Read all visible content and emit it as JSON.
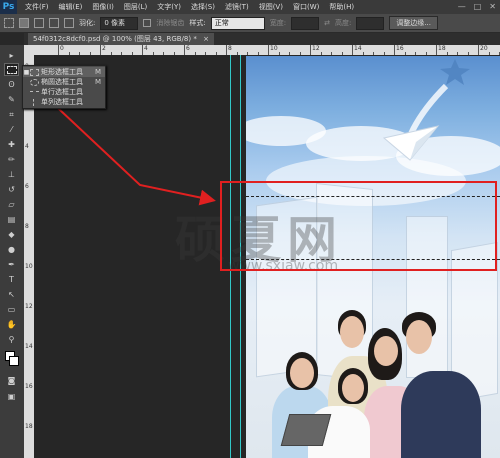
{
  "app": {
    "logo": "Ps",
    "menu": [
      "文件(F)",
      "编辑(E)",
      "图像(I)",
      "图层(L)",
      "文字(Y)",
      "选择(S)",
      "滤镜(T)",
      "视图(V)",
      "窗口(W)",
      "帮助(H)"
    ],
    "window_controls": [
      "—",
      "□",
      "✕"
    ]
  },
  "options": {
    "feather_label": "羽化:",
    "feather_value": "0 像素",
    "antialias_label": "消除锯齿",
    "style_label": "样式:",
    "style_value": "正常",
    "width_label": "宽度:",
    "height_label": "高度:",
    "refine_button": "调整边缘..."
  },
  "document": {
    "tab_title": "54f0312c8dcf0.psd @ 100% (图层 43, RGB/8) *",
    "tab_close": "×"
  },
  "ruler": {
    "top_labels": [
      "0",
      "2",
      "4",
      "6",
      "8",
      "10",
      "12",
      "14",
      "16",
      "18",
      "20"
    ],
    "left_labels": [
      "0",
      "2",
      "4",
      "6",
      "8",
      "10",
      "12",
      "14",
      "16",
      "18",
      "20"
    ]
  },
  "flyout": {
    "items": [
      {
        "label": "矩形选框工具",
        "key": "M",
        "selected": true,
        "icon": "rect-marquee-icon"
      },
      {
        "label": "椭圆选框工具",
        "key": "M",
        "selected": false,
        "icon": "ellipse-marquee-icon"
      },
      {
        "label": "单行选框工具",
        "key": "",
        "selected": false,
        "icon": "single-row-marquee-icon"
      },
      {
        "label": "单列选框工具",
        "key": "",
        "selected": false,
        "icon": "single-column-marquee-icon"
      }
    ]
  },
  "watermark": {
    "main": "硕夏网",
    "sub": "www.sxiaw.com"
  },
  "colors": {
    "annotation_red": "#e02020",
    "guide_cyan": "#32c8c8",
    "ps_blue": "#39a9ee"
  }
}
